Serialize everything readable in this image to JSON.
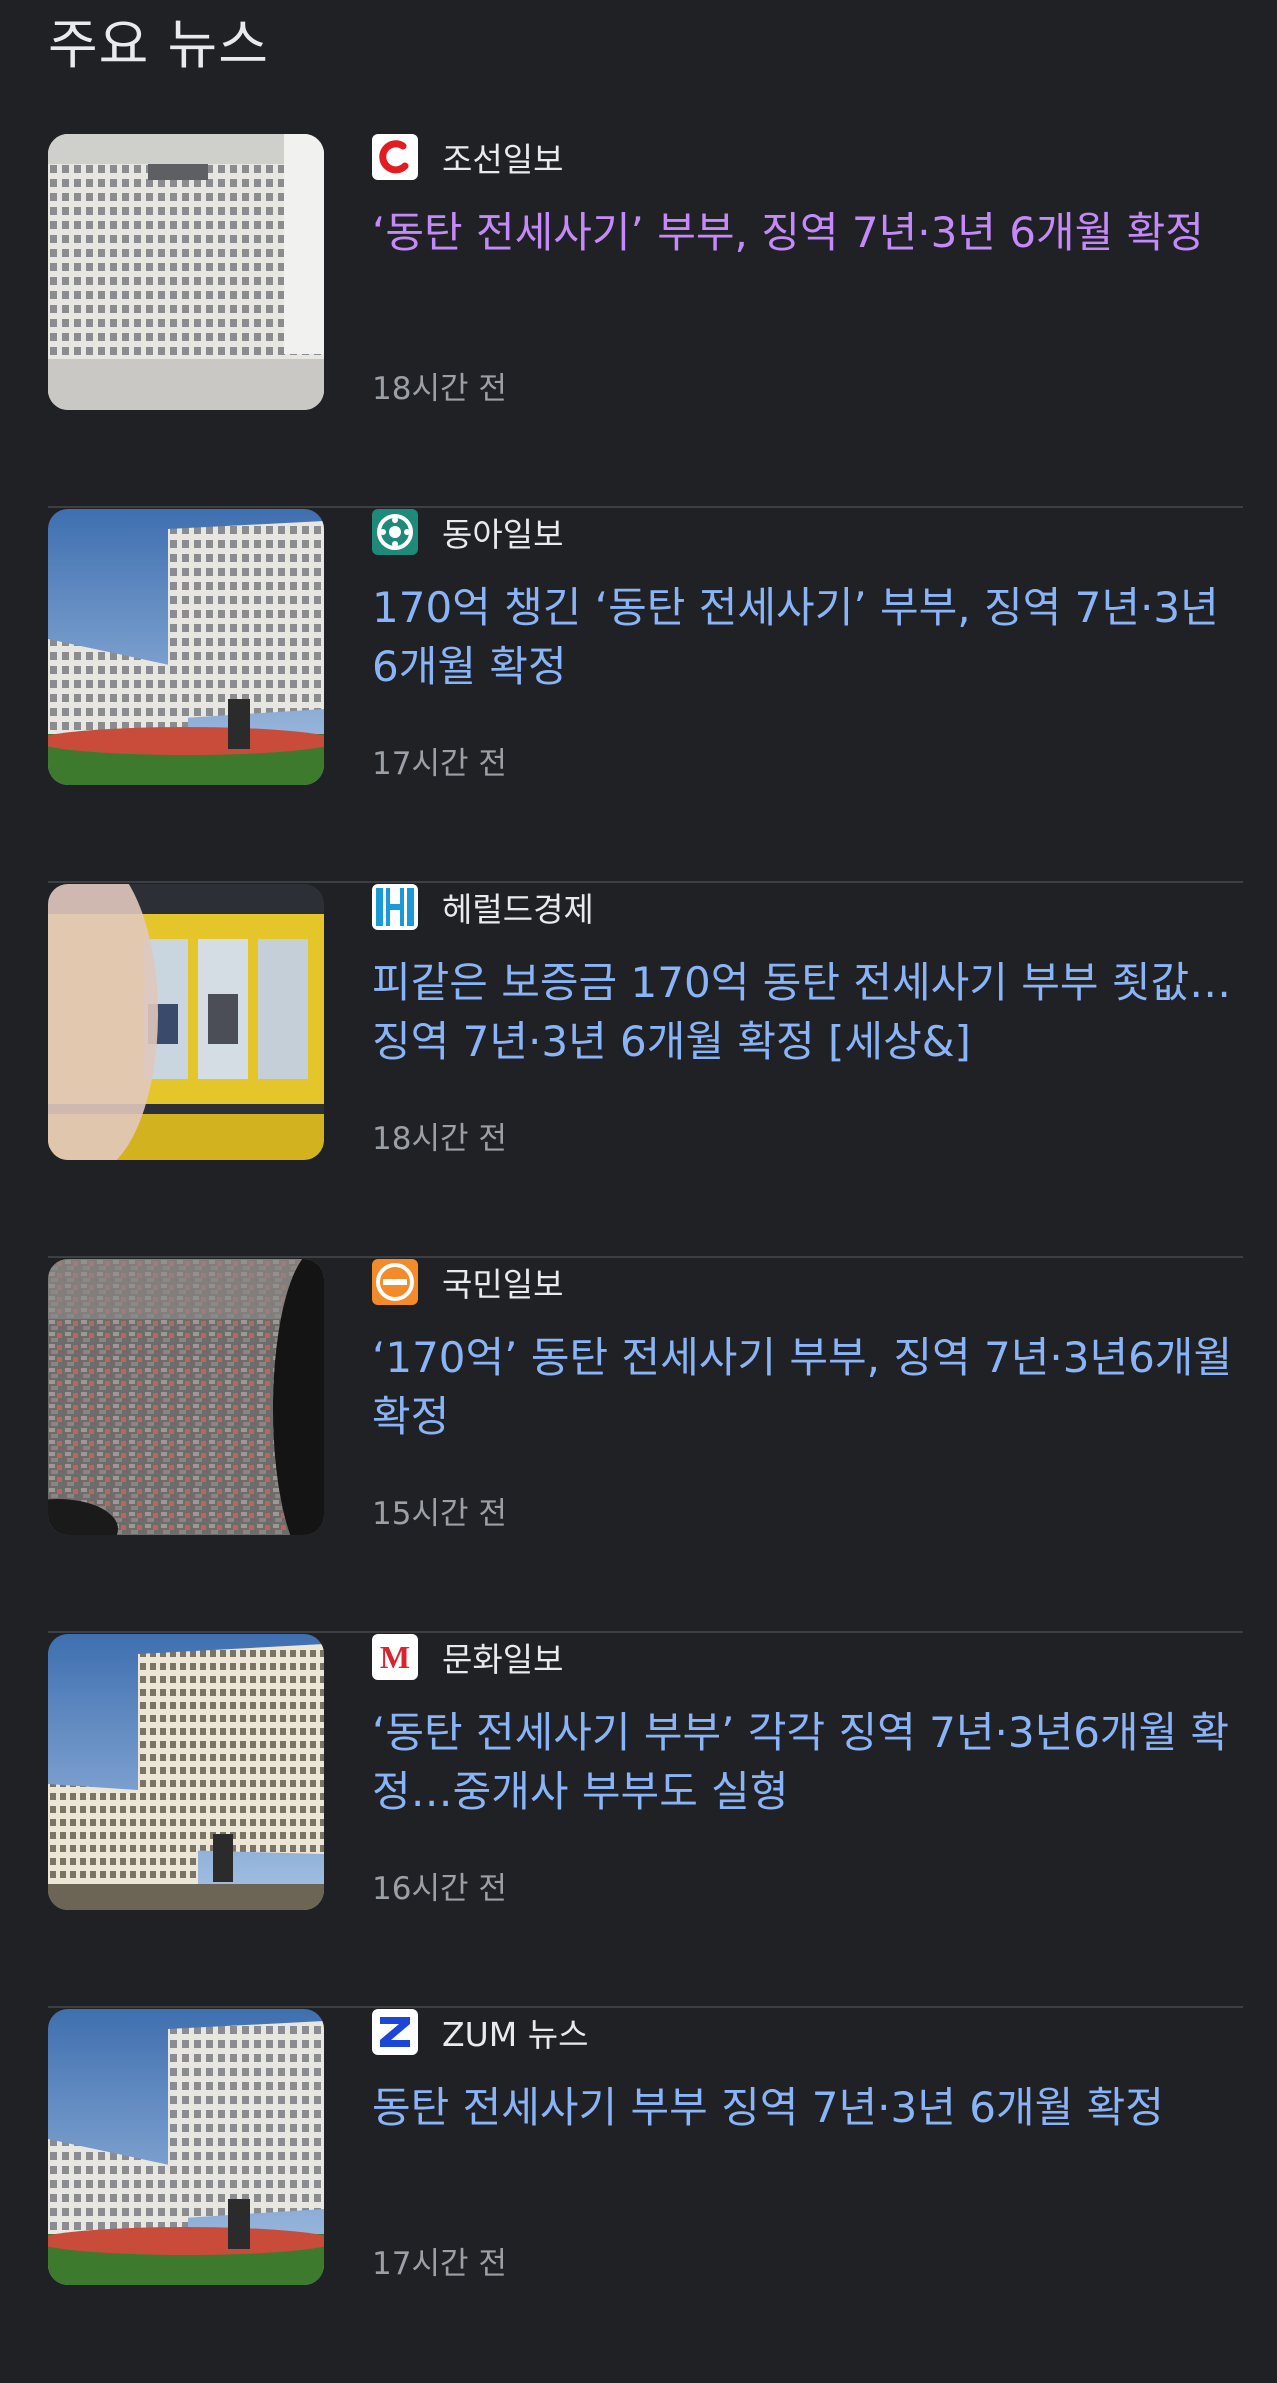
{
  "section": {
    "title": "주요 뉴스"
  },
  "articles": [
    {
      "source": "조선일보",
      "logo_icon": "chosun-logo-icon",
      "headline": "‘동탄 전세사기’ 부부, 징역 7년·3년 6개월 확정",
      "time": "18시간 전",
      "visited": true,
      "thumbnail": "court-building-closeup-image"
    },
    {
      "source": "동아일보",
      "logo_icon": "donga-logo-icon",
      "headline": "170억 챙긴 ‘동탄 전세사기’ 부부, 징역 7년·3년6개월 확정",
      "time": "17시간 전",
      "visited": false,
      "thumbnail": "supreme-court-building-image"
    },
    {
      "source": "헤럴드경제",
      "logo_icon": "herald-logo-icon",
      "headline": "피같은 보증금 170억 동탄 전세사기 부부 죗값…징역 7년·3년 6개월 확정 [세상&]",
      "time": "18시간 전",
      "visited": false,
      "thumbnail": "real-estate-office-window-image"
    },
    {
      "source": "국민일보",
      "logo_icon": "kukmin-logo-icon",
      "headline": "‘170억’ 동탄 전세사기 부부, 징역 7년·3년6개월 확정",
      "time": "15시간 전",
      "visited": false,
      "thumbnail": "city-aerial-view-image"
    },
    {
      "source": "문화일보",
      "logo_icon": "munhwa-logo-icon",
      "headline": "‘동탄 전세사기 부부’ 각각 징역 7년·3년6개월 확정…중개사 부부도 실형",
      "time": "16시간 전",
      "visited": false,
      "thumbnail": "supreme-court-building-image"
    },
    {
      "source": "ZUM 뉴스",
      "logo_icon": "zum-logo-icon",
      "headline": "동탄 전세사기 부부 징역 7년·3년 6개월 확정",
      "time": "17시간 전",
      "visited": false,
      "thumbnail": "supreme-court-building-image"
    }
  ],
  "colors": {
    "background": "#202124",
    "link": "#8ab4f8",
    "visited_link": "#c58af9",
    "meta_text": "#9aa0a6",
    "divider": "#3c4043"
  },
  "logo_text": {
    "munhwa": "M"
  }
}
